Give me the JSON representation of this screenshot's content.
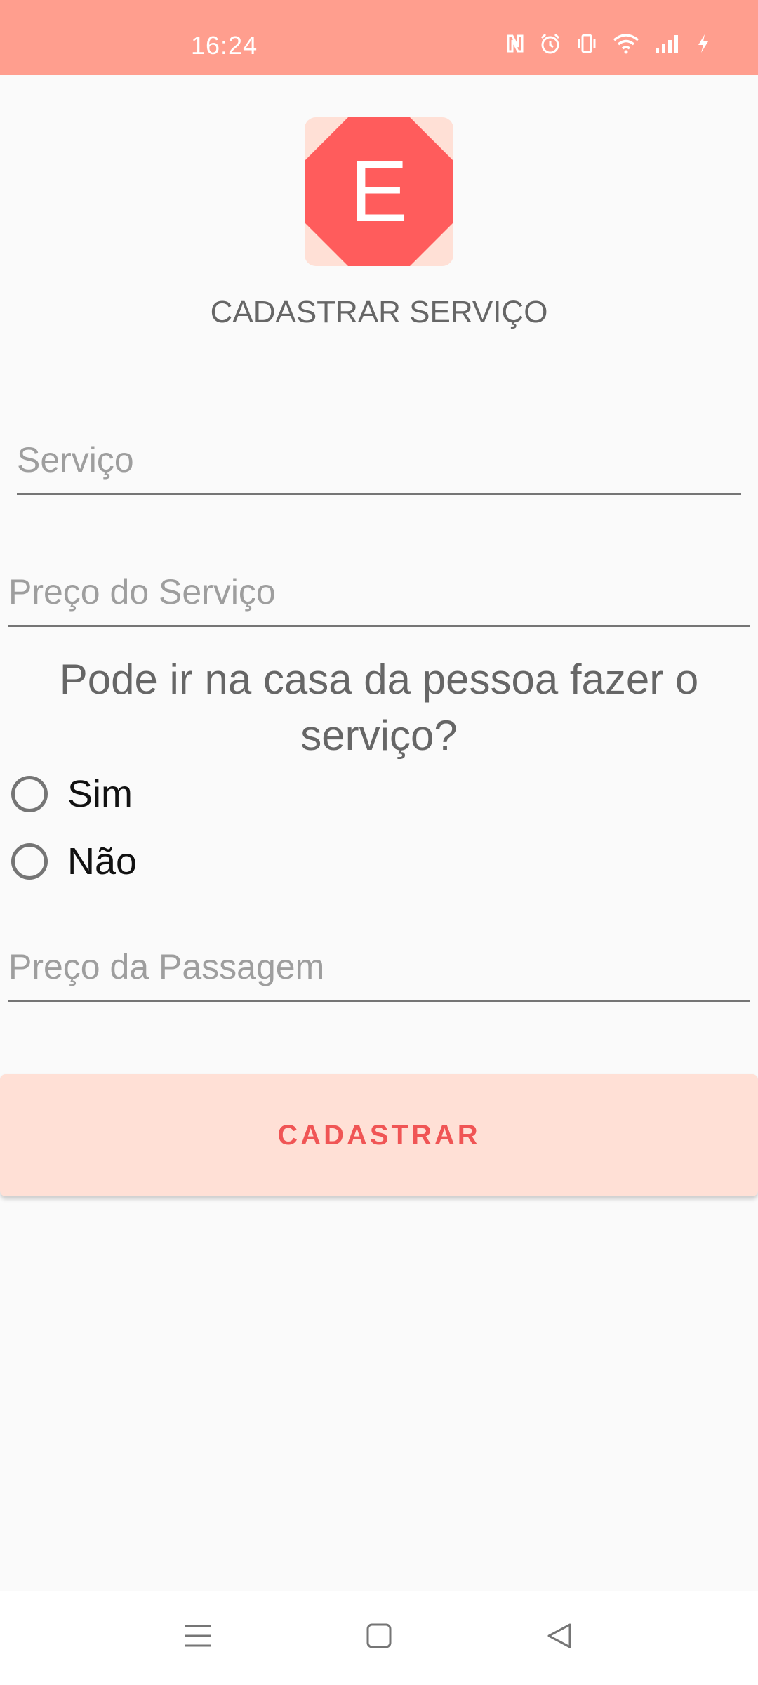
{
  "status_bar": {
    "time": "16:24",
    "icons": [
      "nfc-icon",
      "alarm-icon",
      "vibrate-icon",
      "wifi-icon",
      "signal-icon",
      "charging-icon"
    ]
  },
  "app": {
    "logo_letter": "E",
    "title": "CADASTRAR SERVIÇO"
  },
  "form": {
    "service_placeholder": "Serviço",
    "price_placeholder": "Preço do Serviço",
    "question": "Pode ir na casa da pessoa fazer o serviço?",
    "options": [
      {
        "label": "Sim",
        "selected": false
      },
      {
        "label": "Não",
        "selected": false
      }
    ],
    "fare_placeholder": "Preço da Passagem",
    "submit_label": "CADASTRAR"
  },
  "colors": {
    "status_bar": "#FF9E8E",
    "accent": "#F05555",
    "button_bg": "#FFE0D6",
    "logo_red": "#FF5C5C"
  },
  "nav": {
    "icons": [
      "menu-icon",
      "home-icon",
      "back-icon"
    ]
  }
}
